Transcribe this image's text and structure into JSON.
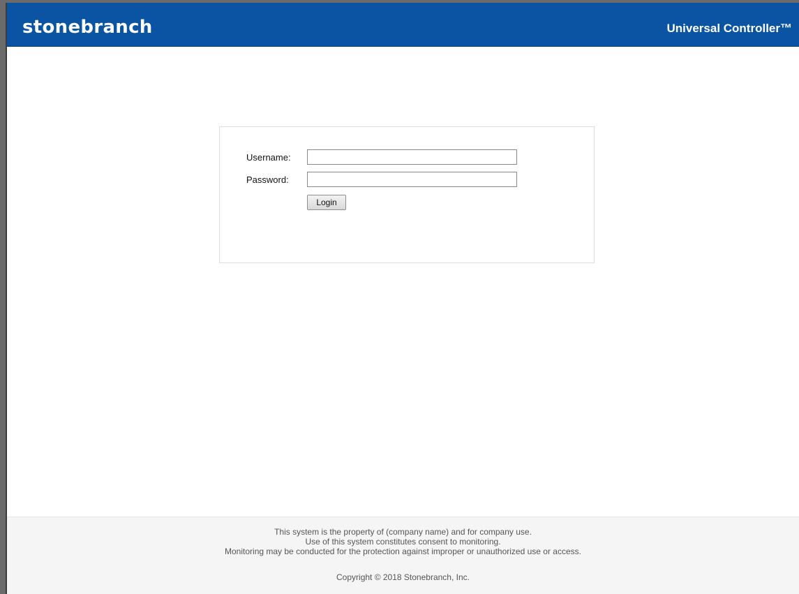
{
  "header": {
    "brand": "stonebranch",
    "product": "Universal Controller™"
  },
  "login_form": {
    "username_label": "Username:",
    "username_value": "",
    "password_label": "Password:",
    "password_value": "",
    "login_button": "Login"
  },
  "footer": {
    "notice_lines": [
      "This system is the property of (company name) and for company use.",
      "Use of this system constitutes consent to monitoring.",
      "Monitoring may be conducted for the protection against improper or unauthorized use or access."
    ],
    "copyright": "Copyright © 2018 Stonebranch, Inc."
  },
  "colors": {
    "header_background": "#0b54a4",
    "footer_background": "#f5f5f5"
  }
}
